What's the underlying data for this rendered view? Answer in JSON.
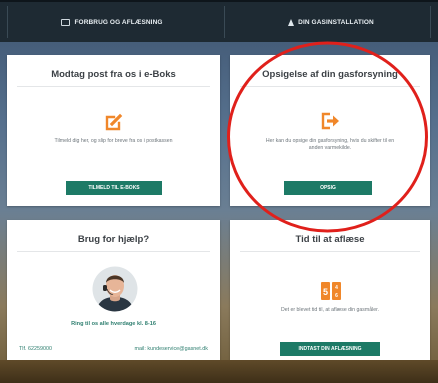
{
  "nav": {
    "item1": "FORBRUG OG AFLÆSNING",
    "item1_icon": "document-icon",
    "item2": "DIN GASINSTALLATION",
    "item2_icon": "flame-icon"
  },
  "cards": {
    "eboks": {
      "title": "Modtag post fra os i e-Boks",
      "icon": "edit-icon",
      "description": "Tilmeld dig her, og slip for breve fra os i postkassen",
      "button": "TILMELD TIL E-BOKS"
    },
    "opsigelse": {
      "title": "Opsigelse af din gasforsyning",
      "icon": "sign-out-icon",
      "description_line1": "Her kan du opsige din gasforsyning, hvis du skifter til en",
      "description_line2": "anden varmekilde.",
      "button": "OPSIG"
    },
    "help": {
      "title": "Brug for hjælp?",
      "photo": "support-person-avatar",
      "ring_text": "Ring til os alle hverdage kl. 8-16",
      "phone": "Tlf. 62259000",
      "email": "mail: kundeservice@gasnet.dk"
    },
    "reading": {
      "title": "Tid til at aflæse",
      "icon": "meter-icon",
      "description": "Det er blevet tid til, at aflæse din gasmåler.",
      "button": "INDTAST DIN AFLÆSNING"
    }
  },
  "colors": {
    "accent_orange": "#f0872a",
    "button_green": "#1d7a66",
    "annotation_red": "#e0201b",
    "topbar": "#1e2a33"
  }
}
